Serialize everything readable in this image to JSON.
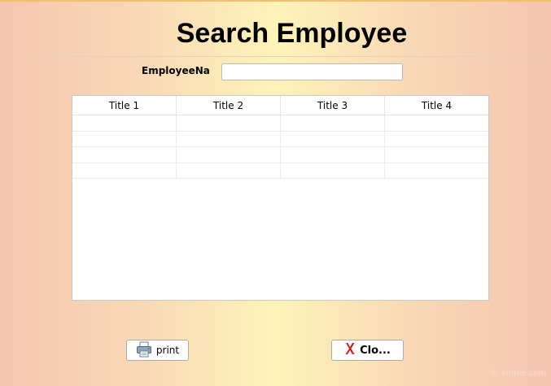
{
  "window": {
    "title": "Search Employee"
  },
  "search": {
    "label": "EmployeeNa...",
    "value": ""
  },
  "grid": {
    "columns": [
      "Title 1",
      "Title 2",
      "Title 3",
      "Title 4"
    ],
    "rows": [
      [
        "",
        "",
        "",
        ""
      ],
      [
        "",
        "",
        "",
        ""
      ],
      [
        "",
        "",
        "",
        ""
      ],
      [
        "",
        "",
        "",
        ""
      ]
    ]
  },
  "buttons": {
    "print": "print",
    "close": "Clo..."
  },
  "icons": {
    "print": "printer-icon",
    "close": "close-x-icon"
  },
  "colors": {
    "close_icon": "#d42020"
  },
  "watermark": "© xmple.com"
}
